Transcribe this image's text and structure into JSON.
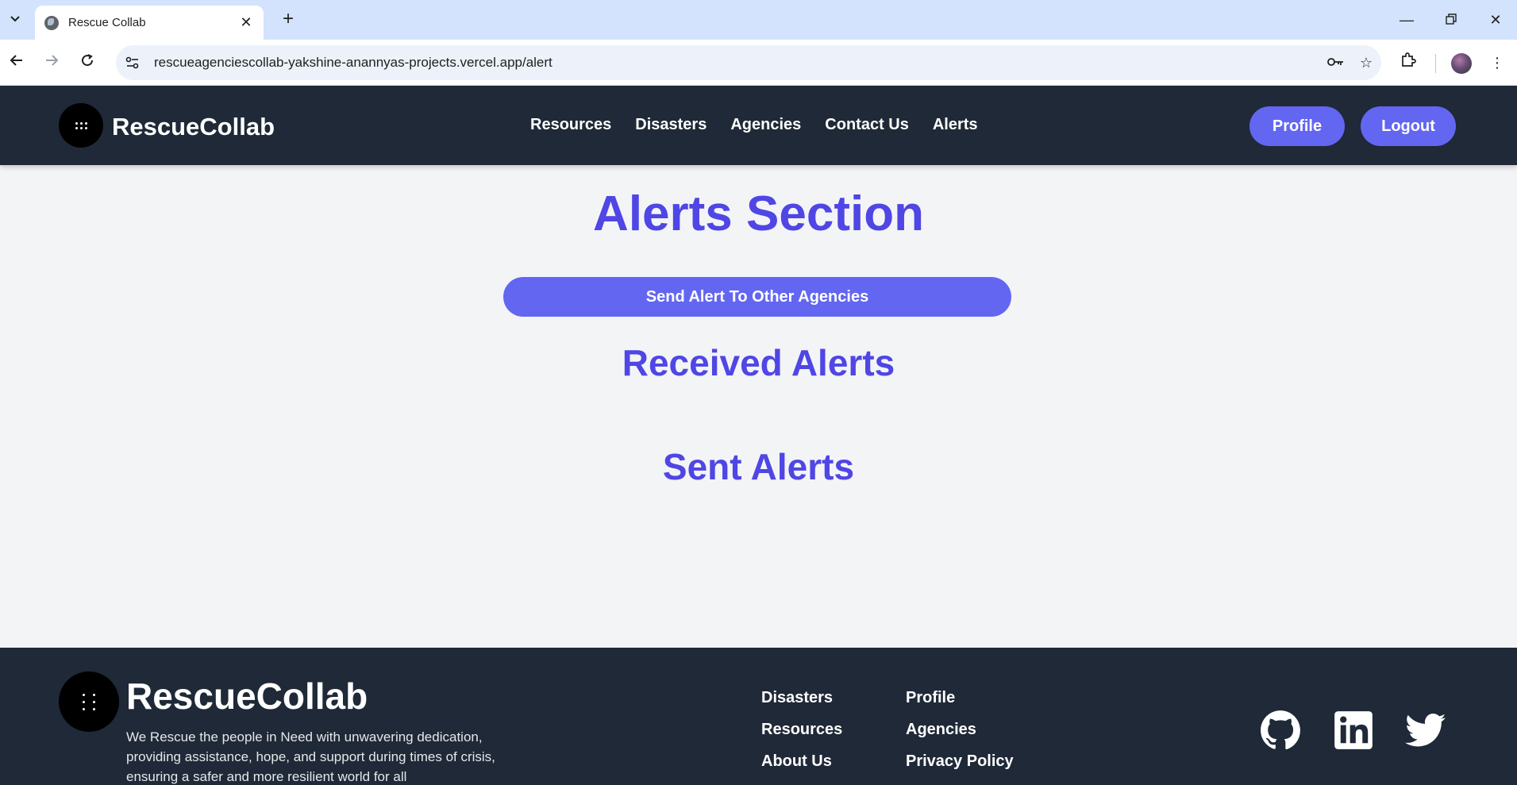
{
  "browser": {
    "tab_title": "Rescue Collab",
    "url": "rescueagenciescollab-yakshine-anannyas-projects.vercel.app/alert"
  },
  "header": {
    "brand": "RescueCollab",
    "nav": [
      "Resources",
      "Disasters",
      "Agencies",
      "Contact Us",
      "Alerts"
    ],
    "profile_label": "Profile",
    "logout_label": "Logout"
  },
  "main": {
    "title": "Alerts Section",
    "send_button_label": "Send Alert To Other Agencies",
    "received_heading": "Received Alerts",
    "sent_heading": "Sent Alerts"
  },
  "footer": {
    "brand": "RescueCollab",
    "description": "We Rescue the people in Need with unwavering dedication, providing assistance, hope, and support during times of crisis, ensuring a safer and more resilient world for all",
    "col1": [
      "Disasters",
      "Resources",
      "About Us"
    ],
    "col2": [
      "Profile",
      "Agencies",
      "Privacy Policy"
    ],
    "social_icons": [
      "github-icon",
      "linkedin-icon",
      "twitter-icon"
    ]
  },
  "colors": {
    "header_bg": "#1f2937",
    "accent": "#6366f1",
    "heading": "#4f46e5",
    "page_bg": "#f3f4f6"
  }
}
